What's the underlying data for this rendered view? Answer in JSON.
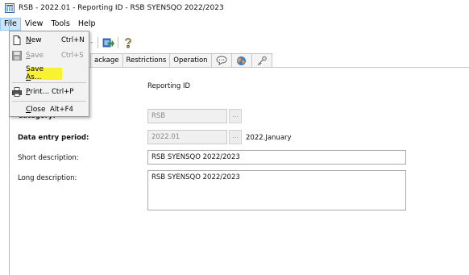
{
  "window": {
    "title": "RSB - 2022.01 - Reporting ID - RSB SYENSQO 2022/2023"
  },
  "menubar": {
    "items": [
      {
        "label": "File",
        "active": true
      },
      {
        "label": "View",
        "active": false
      },
      {
        "label": "Tools",
        "active": false
      },
      {
        "label": "Help",
        "active": false
      }
    ]
  },
  "file_menu": {
    "new": {
      "label_mnemonic": "N",
      "label_rest": "ew",
      "shortcut": "Ctrl+N"
    },
    "save": {
      "label_mnemonic": "S",
      "label_rest": "ave",
      "shortcut": "Ctrl+S",
      "disabled": true
    },
    "save_as": {
      "label_pre": "Save ",
      "label_mnemonic": "A",
      "label_rest": "s...",
      "highlighted": true
    },
    "print": {
      "label_mnemonic": "P",
      "label_rest": "rint...",
      "shortcut": "Ctrl+P"
    },
    "close": {
      "label_mnemonic": "C",
      "label_rest": "lose",
      "shortcut": "Alt+F4"
    }
  },
  "toolbar": {
    "dropdown_arrow_text": "-"
  },
  "tabs": [
    {
      "label": "ackage",
      "kind": "text"
    },
    {
      "label": "Restrictions",
      "kind": "text"
    },
    {
      "label": "Operation",
      "kind": "text"
    },
    {
      "label": "",
      "kind": "icon",
      "icon": "speech-bubble-icon"
    },
    {
      "label": "",
      "kind": "icon",
      "icon": "globe-icon"
    },
    {
      "label": "",
      "kind": "icon",
      "icon": "key-icon"
    }
  ],
  "form": {
    "type_value": "Reporting ID",
    "category_label": "Category:",
    "category_value": "RSB",
    "period_label": "Data entry period:",
    "period_value": "2022.01",
    "period_text": "2022.January",
    "short_desc_label": "Short description:",
    "short_desc_value": "RSB SYENSQO 2022/2023",
    "long_desc_label": "Long description:",
    "long_desc_value": "RSB SYENSQO 2022/2023",
    "dots": "..."
  },
  "colors": {
    "menu_active_bg": "#cce4f7",
    "highlight": "#f9f232",
    "disabled_input_bg": "#f0f0f0"
  }
}
